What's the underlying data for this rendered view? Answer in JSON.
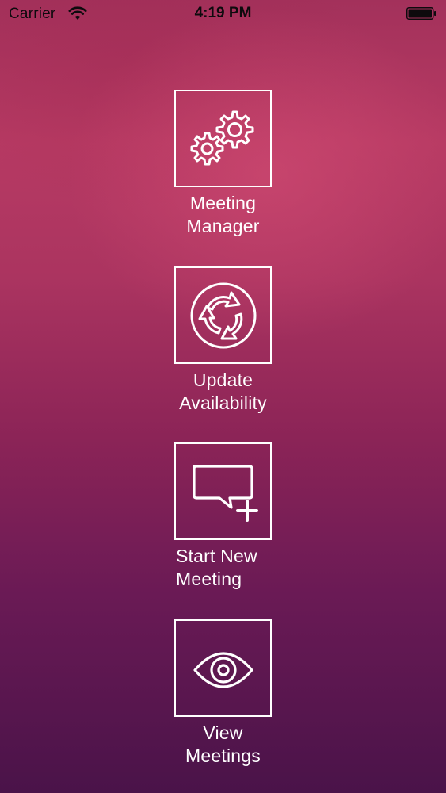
{
  "status_bar": {
    "carrier": "Carrier",
    "time": "4:19 PM",
    "wifi_icon": "wifi-icon",
    "battery_icon": "battery-icon"
  },
  "menu": {
    "items": [
      {
        "line1": "Meeting",
        "line2": "Manager",
        "icon": "gears-icon"
      },
      {
        "line1": "Update",
        "line2": "Availability",
        "icon": "refresh-cycle-icon"
      },
      {
        "line1": "Start New",
        "line2": "Meeting",
        "icon": "chat-add-icon"
      },
      {
        "line1": "View",
        "line2": "Meetings",
        "icon": "eye-icon"
      }
    ]
  }
}
